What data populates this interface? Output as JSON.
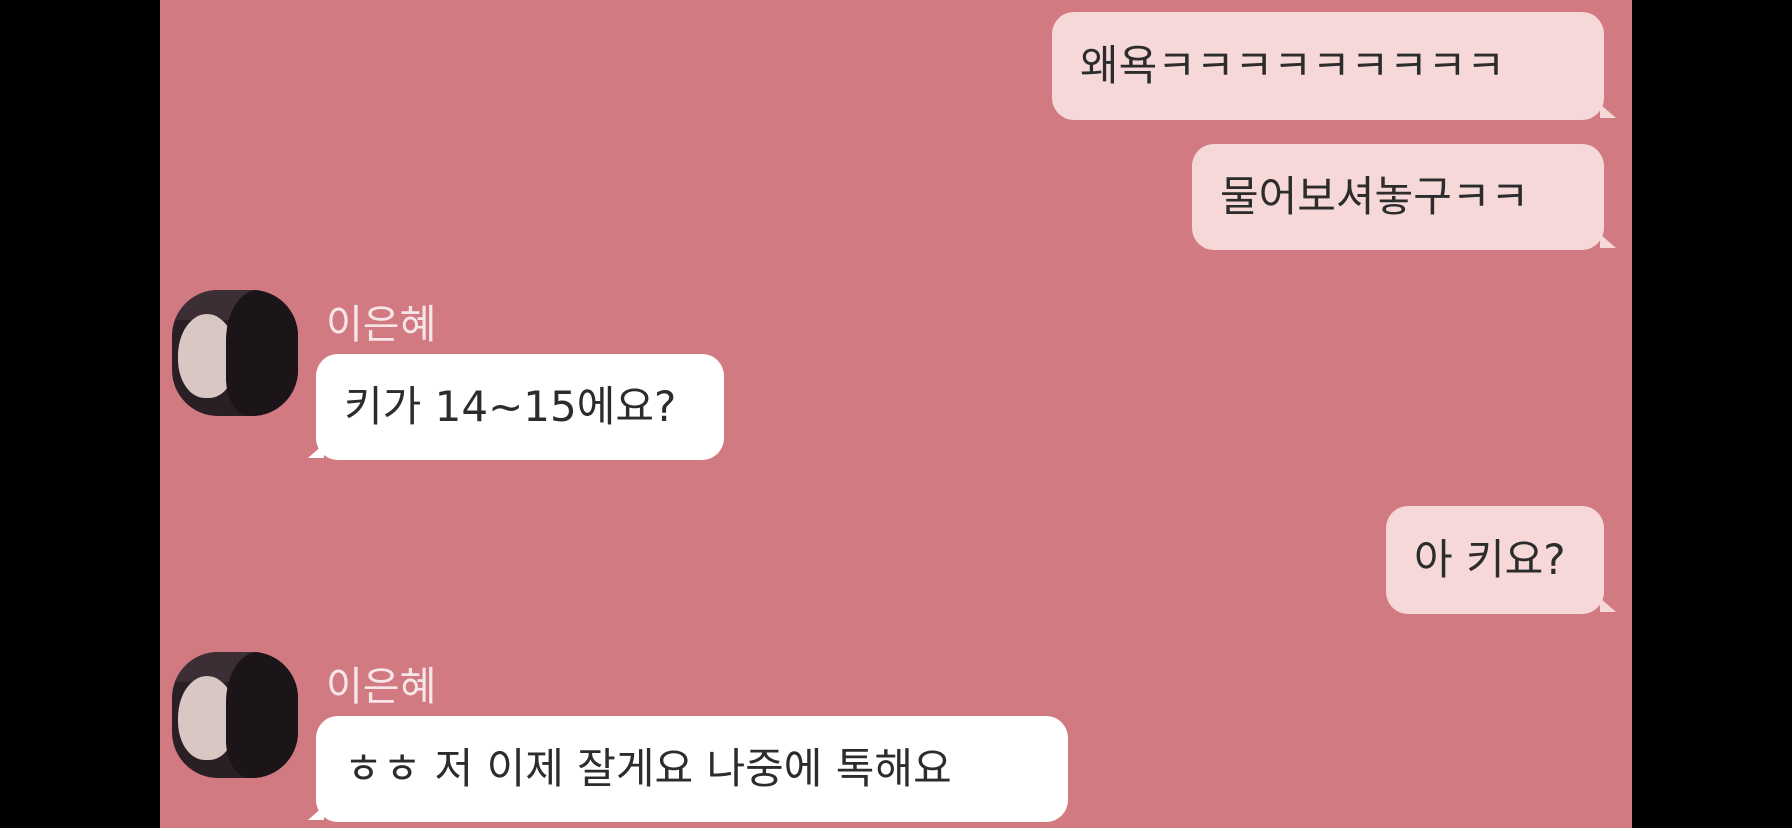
{
  "colors": {
    "background": "#d27a82",
    "outgoing_bubble": "#f6d8d9",
    "incoming_bubble": "#ffffff",
    "sender_name": "#f7e6e7",
    "letterbox": "#000000"
  },
  "messages": [
    {
      "direction": "outgoing",
      "text": "왜욕ㅋㅋㅋㅋㅋㅋㅋㅋㅋ"
    },
    {
      "direction": "outgoing",
      "text": "물어보셔놓구ㅋㅋ"
    },
    {
      "direction": "incoming",
      "sender": "이은혜",
      "avatar_icon": "profile-photo",
      "text": "키가 14~15에요?"
    },
    {
      "direction": "outgoing",
      "text": "아 키요?"
    },
    {
      "direction": "incoming",
      "sender": "이은혜",
      "avatar_icon": "profile-photo",
      "text": "ㅎㅎ 저 이제 잘게요 나중에 톡해요"
    }
  ]
}
